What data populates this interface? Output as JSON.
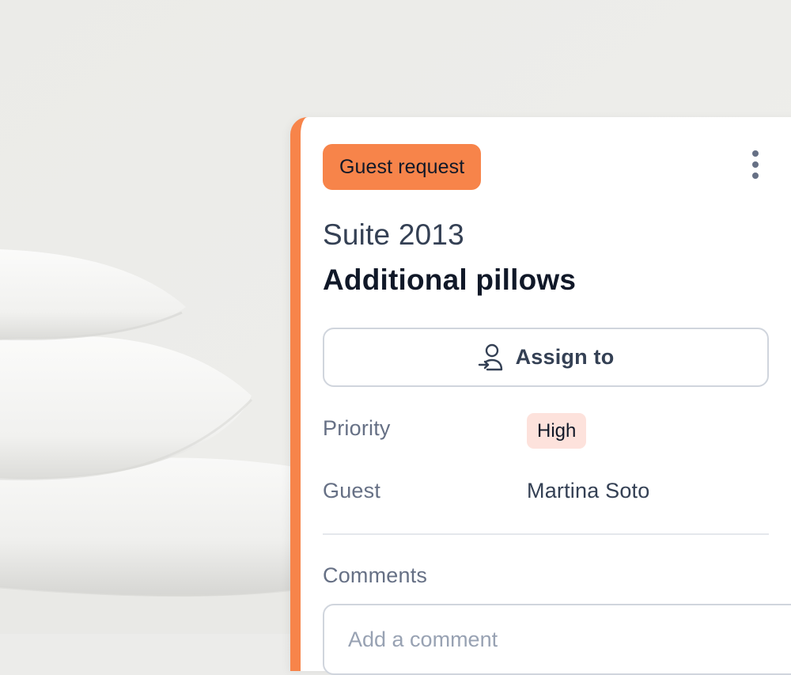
{
  "task_card": {
    "type_badge": "Guest request",
    "room": "Suite 2013",
    "title": "Additional pillows",
    "assign_button_label": "Assign to",
    "fields": {
      "priority_label": "Priority",
      "priority_value": "High",
      "guest_label": "Guest",
      "guest_value": "Martina Soto"
    },
    "comments_label": "Comments",
    "comment_placeholder": "Add a comment"
  },
  "icons": {
    "menu": "more-vertical-icon",
    "assign": "user-assign-icon"
  },
  "colors": {
    "accent": "#f7844a",
    "priority_high_bg": "#fde2dc"
  }
}
